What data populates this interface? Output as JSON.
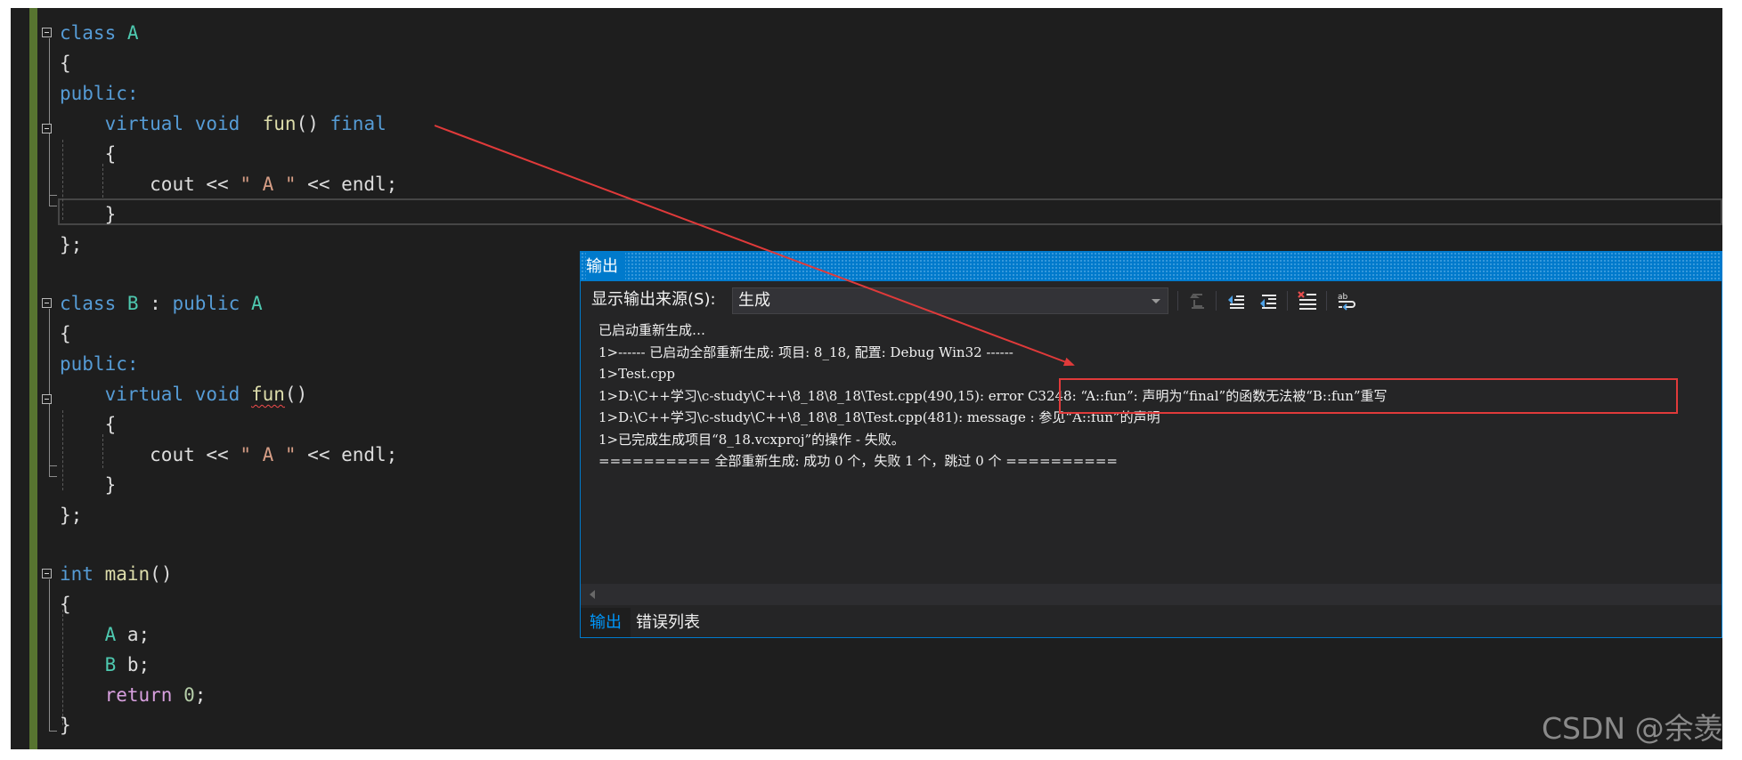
{
  "editor": {
    "lines": {
      "l1": {
        "kw": "class",
        "name": "A"
      },
      "l2": {
        "text": "{"
      },
      "l3": {
        "text": "public:"
      },
      "l4": {
        "kw1": "virtual",
        "kw2": "void",
        "fn": "fun",
        "parens": "()",
        "final": "final"
      },
      "l5": {
        "text": "{"
      },
      "l6": {
        "cout": "cout << ",
        "str": "\" A \"",
        "rest": " << endl;"
      },
      "l7": {
        "text": "}"
      },
      "l8": {
        "text": "};"
      },
      "l9": {
        "kw": "class",
        "name": "B",
        "colon": " : ",
        "kw2": "public",
        "base": "A"
      },
      "l10": {
        "text": "{"
      },
      "l11": {
        "text": "public:"
      },
      "l12": {
        "kw1": "virtual",
        "kw2": "void",
        "fn": "fun",
        "parens": "()"
      },
      "l13": {
        "text": "{"
      },
      "l14": {
        "cout": "cout << ",
        "str": "\" A \"",
        "rest": " << endl;"
      },
      "l15": {
        "text": "}"
      },
      "l16": {
        "text": "};"
      },
      "l17": {
        "kw": "int",
        "fn": "main",
        "parens": "()"
      },
      "l18": {
        "text": "{"
      },
      "l19": {
        "type": "A",
        "rest": " a;"
      },
      "l20": {
        "type": "B",
        "rest": " b;"
      },
      "l21": {
        "kw": "return",
        "num": "0",
        "semi": ";"
      },
      "l22": {
        "text": "}"
      }
    }
  },
  "output_panel": {
    "title": "输出",
    "source_label": "显示输出来源(S):",
    "source_value": "生成",
    "lines": [
      "已启动重新生成…",
      "1>------ 已启动全部重新生成: 项目: 8_18, 配置: Debug Win32 ------",
      "1>Test.cpp",
      "1>D:\\C++学习\\c-study\\C++\\8_18\\8_18\\Test.cpp(490,15): error C3248: “A::fun”: 声明为“final”的函数无法被“B::fun”重写",
      "1>D:\\C++学习\\c-study\\C++\\8_18\\8_18\\Test.cpp(481): message : 参见“A::fun”的声明",
      "1>已完成生成项目“8_18.vcxproj”的操作 - 失败。",
      "========== 全部重新生成: 成功 0 个，失败 1 个，跳过 0 个 =========="
    ],
    "tabs": {
      "output": "输出",
      "errors": "错误列表"
    },
    "toolbar_icons": [
      "go-to-message-icon",
      "previous-message-icon",
      "next-message-icon",
      "clear-all-icon",
      "word-wrap-icon"
    ]
  },
  "annotation": {
    "color": "#e03a3a"
  },
  "colors": {
    "editor_bg": "#1e1e1e",
    "panel_bg": "#252526",
    "accent": "#007acc",
    "keyword": "#569cd6",
    "type": "#4ec9b0",
    "function": "#dcdcaa",
    "string": "#d69d85"
  },
  "watermark": "CSDN @余羡"
}
